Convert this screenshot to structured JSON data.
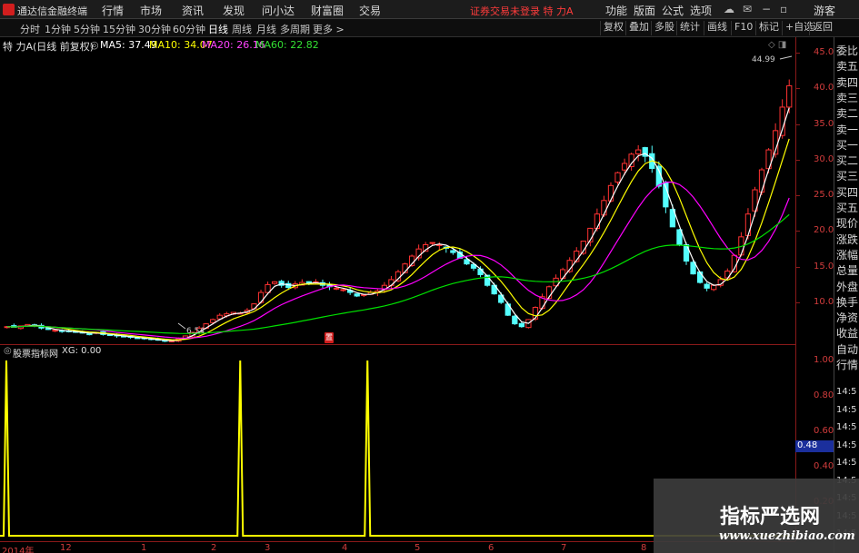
{
  "app": {
    "title": "通达信金融终端",
    "menu": [
      "行情",
      "市场",
      "资讯",
      "发现",
      "问小达",
      "财富圈",
      "交易"
    ],
    "notice": "证券交易未登录  特 力A",
    "right_menu": [
      "功能",
      "版面",
      "公式",
      "选项"
    ],
    "guest": "游客",
    "brand_color": "#d21e1e"
  },
  "toolbar": {
    "periods": [
      "分时",
      "1分钟",
      "5分钟",
      "15分钟",
      "30分钟",
      "60分钟",
      "日线",
      "周线",
      "月线",
      "多周期",
      "更多 >"
    ],
    "active": "日线",
    "right_buttons": [
      "复权",
      "叠加",
      "多股",
      "统计",
      "画线",
      "F10",
      "标记",
      "+自选",
      "返回"
    ]
  },
  "chart_info": {
    "stock": "特 力A",
    "mode": "(日线 前复权)",
    "ma5": "MA5: 37.49",
    "ma10": "MA10: 34.07",
    "ma20": "MA20: 26.16",
    "ma60": "MA60: 22.82",
    "high_marker": "44.99",
    "low_marker": "6.54",
    "badge": "置"
  },
  "oscillator": {
    "name": "股票指标网",
    "value": "XG: 0.00",
    "highlight": "0.48"
  },
  "price_axis": [
    "45.00",
    "40.00",
    "35.00",
    "30.00",
    "25.00",
    "20.00",
    "15.00",
    "10.00"
  ],
  "osc_axis": [
    "1.00",
    "0.80",
    "0.60",
    "0.40",
    "0.20"
  ],
  "date_axis": [
    "2014年",
    "12",
    "1",
    "2",
    "3",
    "4",
    "5",
    "6",
    "7",
    "8"
  ],
  "side_panel": {
    "items": [
      "委比",
      "卖五",
      "卖四",
      "卖三",
      "卖二",
      "卖一",
      "买一",
      "买二",
      "买三",
      "买四",
      "买五",
      "现价",
      "涨跌",
      "涨幅",
      "总量",
      "外盘",
      "换手",
      "净资",
      "收益",
      "自动",
      "行情"
    ],
    "times": [
      "14:5",
      "14:5",
      "14:5",
      "14:5",
      "14:5",
      "14:5",
      "14:5",
      "14:5",
      "14:5"
    ]
  },
  "watermark": {
    "title": "指标严选网",
    "url": "www.xuezhibiao.com"
  },
  "colors": {
    "up": "#ff3232",
    "down": "#54ffff",
    "ma5": "#ffffff",
    "ma10": "#ffff00",
    "ma20": "#ff00ff",
    "ma60": "#00e000",
    "osc_line": "#ffff00"
  },
  "chart_data": [
    {
      "type": "candlestick",
      "title": "特 力A (日线 前复权)",
      "ylim": [
        6.54,
        44.99
      ],
      "y_ticks": [
        10,
        15,
        20,
        25,
        30,
        35,
        40,
        45
      ],
      "x_ticks": [
        "2014年",
        "12",
        "1",
        "2",
        "3",
        "4",
        "5",
        "6",
        "7",
        "8"
      ],
      "close_path": [
        8.6,
        8.5,
        8.7,
        8.9,
        8.8,
        8.4,
        8.2,
        8.1,
        8.0,
        7.9,
        7.8,
        7.7,
        7.6,
        7.8,
        7.5,
        7.4,
        7.3,
        7.2,
        7.1,
        7.0,
        6.9,
        6.8,
        6.7,
        6.6,
        6.6,
        6.9,
        7.3,
        7.8,
        8.4,
        9.0,
        9.6,
        10.2,
        10.4,
        10.6,
        10.5,
        10.9,
        11.8,
        13.4,
        14.5,
        14.9,
        14.4,
        14.1,
        14.6,
        14.8,
        14.6,
        14.9,
        14.4,
        14.2,
        14.0,
        13.8,
        13.4,
        12.9,
        13.1,
        13.4,
        13.6,
        14.4,
        15.2,
        16.3,
        17.4,
        18.5,
        19.5,
        20.1,
        20.4,
        20.1,
        19.6,
        19.0,
        18.2,
        17.4,
        16.8,
        15.9,
        14.4,
        13.2,
        12.0,
        10.2,
        9.0,
        8.6,
        9.6,
        11.3,
        12.8,
        14.2,
        15.4,
        16.6,
        17.9,
        19.2,
        20.6,
        22.4,
        24.4,
        26.3,
        28.4,
        30.2,
        31.5,
        32.8,
        33.4,
        32.5,
        30.8,
        28.3,
        25.4,
        22.6,
        20.1,
        17.8,
        16.0,
        14.8,
        14.0,
        14.4,
        15.2,
        16.4,
        18.6,
        21.2,
        24.4,
        27.8,
        30.6,
        33.4,
        36.1,
        39.4,
        42.4
      ],
      "series": [
        {
          "name": "MA5",
          "values": [
            37.49
          ]
        },
        {
          "name": "MA10",
          "values": [
            34.07
          ]
        },
        {
          "name": "MA20",
          "values": [
            26.16
          ]
        },
        {
          "name": "MA60",
          "values": [
            22.82
          ]
        }
      ]
    },
    {
      "type": "line",
      "title": "股票指标网",
      "series": [
        {
          "name": "XG",
          "values": [
            0.0
          ]
        }
      ],
      "ylim": [
        0,
        1
      ],
      "y_ticks": [
        0.2,
        0.4,
        0.6,
        0.8,
        1.0
      ],
      "spikes_x_fraction": [
        0.008,
        0.302,
        0.462
      ],
      "spike_value": 1.0
    }
  ]
}
